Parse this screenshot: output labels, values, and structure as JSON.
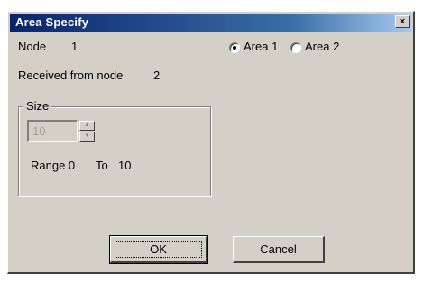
{
  "window": {
    "title": "Area Specify",
    "close_glyph": "×"
  },
  "info": {
    "node_label": "Node",
    "node_value": "1",
    "received_label": "Received from node",
    "received_value": "2"
  },
  "area": {
    "options": [
      {
        "label": "Area 1",
        "checked": true
      },
      {
        "label": "Area 2",
        "checked": false
      }
    ]
  },
  "size": {
    "group_label": "Size",
    "value": "10",
    "range_label": "Range 0",
    "to_label": "To",
    "to_value": "10",
    "up_glyph": "▲",
    "down_glyph": "▼"
  },
  "buttons": {
    "ok_label": "OK",
    "cancel_label": "Cancel"
  }
}
